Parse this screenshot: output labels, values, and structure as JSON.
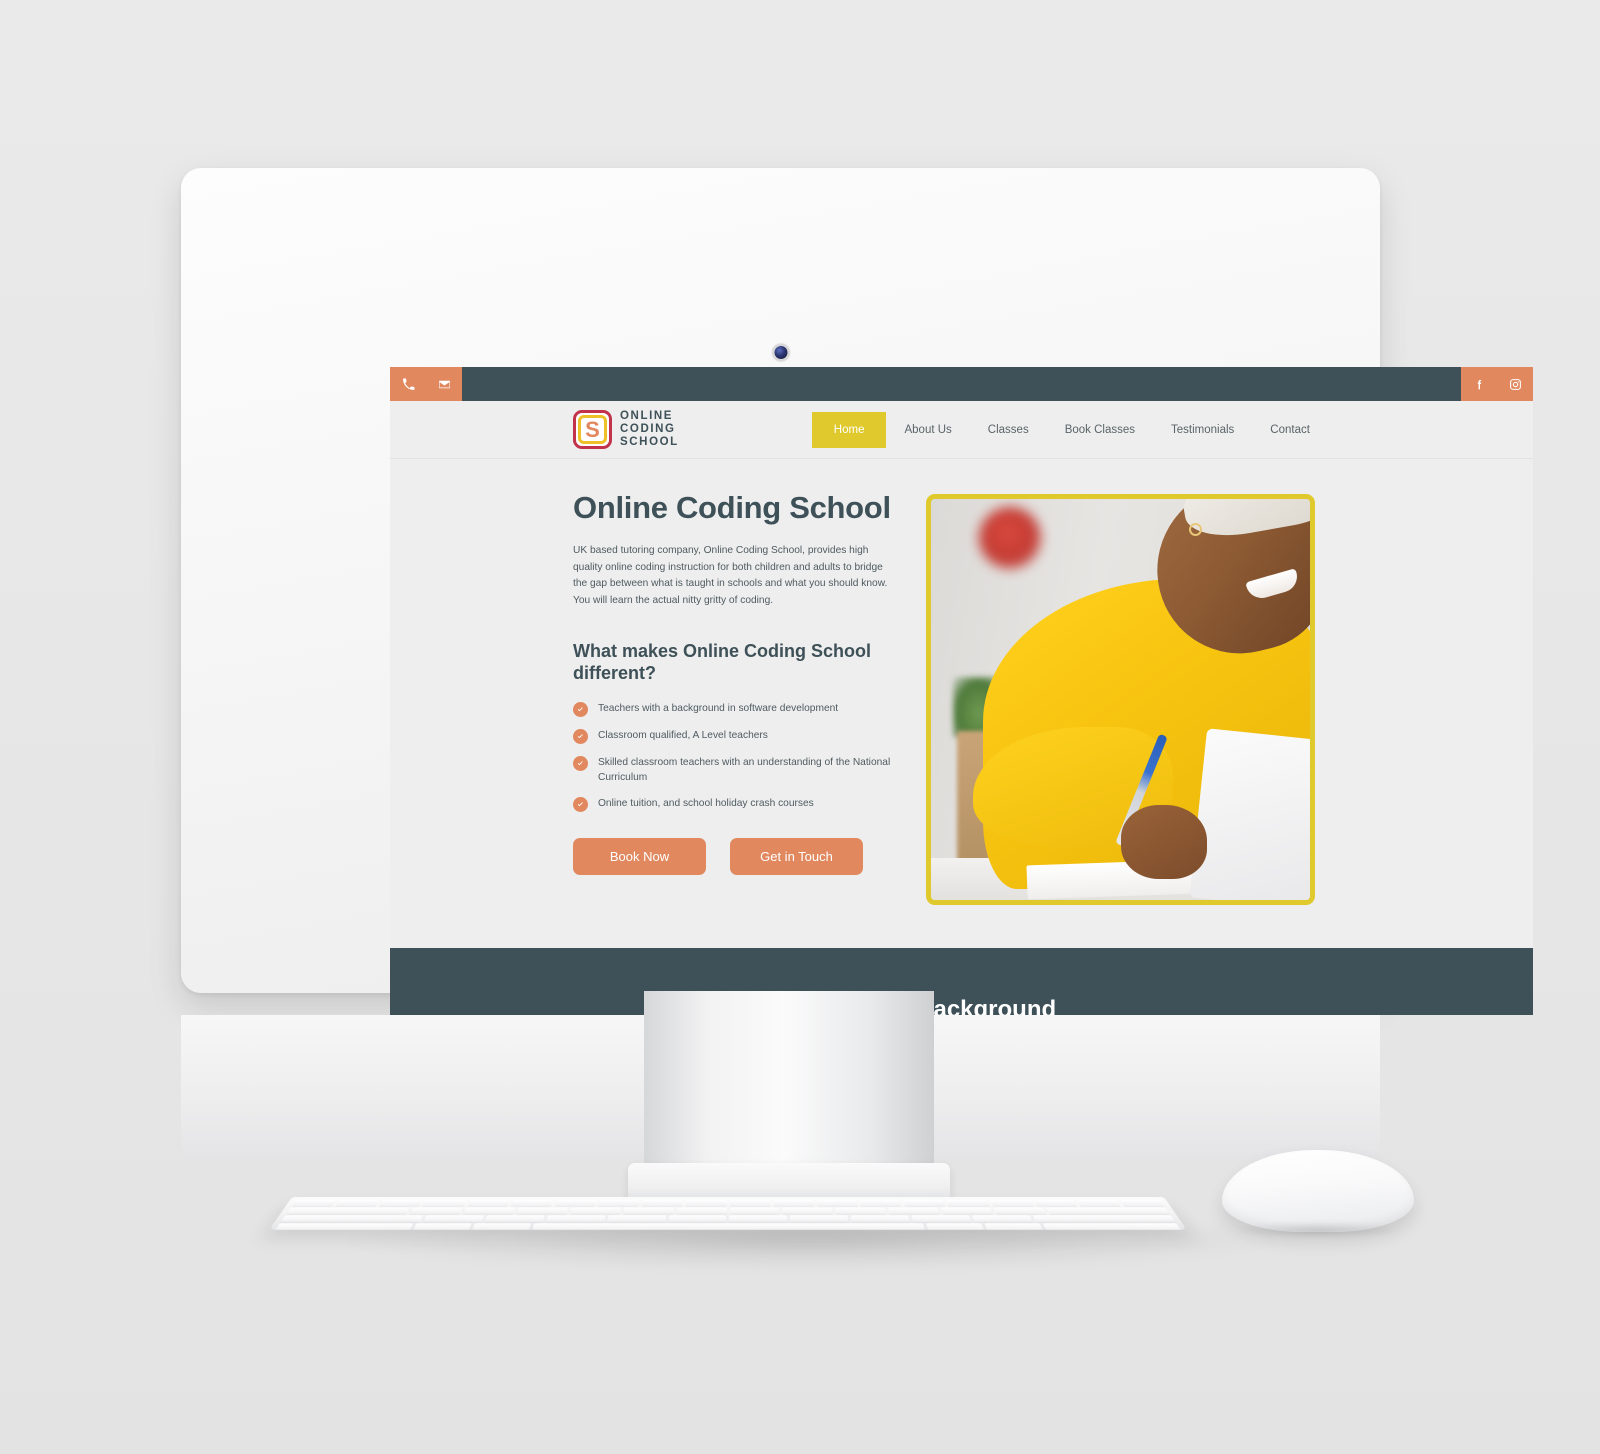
{
  "topbar": {
    "phone_icon": "phone-icon",
    "email_icon": "envelope-icon",
    "facebook_icon": "facebook-icon",
    "instagram_icon": "instagram-icon"
  },
  "header": {
    "logo_letter": "S",
    "logo_line1": "ONLINE",
    "logo_line2": "CODING",
    "logo_line3": "SCHOOL",
    "nav": [
      {
        "label": "Home",
        "active": true
      },
      {
        "label": "About Us",
        "active": false
      },
      {
        "label": "Classes",
        "active": false
      },
      {
        "label": "Book Classes",
        "active": false
      },
      {
        "label": "Testimonials",
        "active": false
      },
      {
        "label": "Contact",
        "active": false
      }
    ]
  },
  "hero": {
    "title": "Online Coding School",
    "paragraph": "UK based tutoring company, Online Coding School, provides high quality online coding instruction for both children and adults to bridge the gap between what is taught in schools and what you should know. You will learn the actual nitty gritty of coding.",
    "subheading": "What makes Online Coding School different?",
    "features": [
      "Teachers with a background in software development",
      "Classroom qualified, A Level teachers",
      "Skilled classroom teachers with an understanding of the National Curriculum",
      "Online tuition, and school holiday crash courses"
    ],
    "primary_button": "Book Now",
    "secondary_button": "Get in Touch",
    "image_alt": "student-writing-photo"
  },
  "next_section": {
    "heading": "Our Background"
  },
  "colors": {
    "dark_slate": "#3E5158",
    "orange": "#E1885F",
    "yellow": "#E0C92C",
    "logo_crimson": "#C2334B",
    "logo_yellow": "#EFC129",
    "page_bg": "#EEEEEE"
  },
  "device": {
    "type": "desktop-monitor",
    "webcam": "webcam-lens",
    "keyboard": "keyboard",
    "mouse": "mouse"
  }
}
